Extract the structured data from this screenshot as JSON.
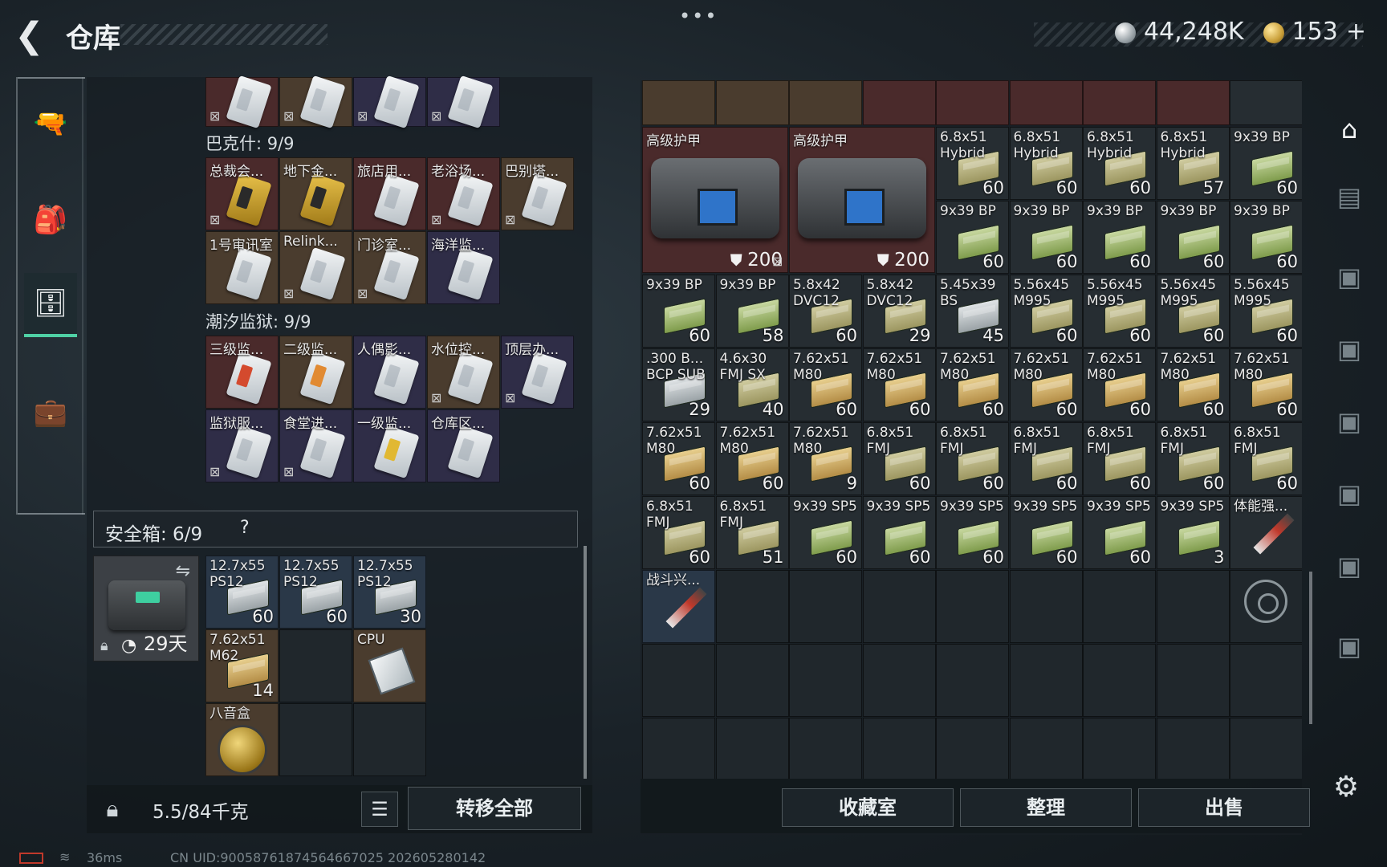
{
  "header": {
    "back_icon": "back-arrow-icon",
    "title": "仓库",
    "more": "•••"
  },
  "currency": {
    "silver_value": "44,248K",
    "gold_value": "153",
    "gold_plus": "+"
  },
  "left_nav": {
    "items": [
      {
        "icon": "gun-icon",
        "glyph": "🔫",
        "active": false
      },
      {
        "icon": "backpack-icon",
        "glyph": "🎒",
        "active": false
      },
      {
        "icon": "container-icon",
        "glyph": "🗄",
        "active": true
      },
      {
        "icon": "briefcase-icon",
        "glyph": "💼",
        "active": false
      }
    ]
  },
  "left_panel": {
    "sections": {
      "bakesh": "巴克什: 9/9",
      "chaoxi": "潮汐监狱: 9/9"
    },
    "top_row": [
      {
        "color": "c-red",
        "flag": "⊠"
      },
      {
        "color": "c-gold",
        "flag": "⊠"
      },
      {
        "color": "c-purple",
        "flag": "⊠"
      },
      {
        "color": "c-purple",
        "flag": "⊠"
      }
    ],
    "bakesh_items": [
      {
        "name": "总裁会...",
        "color": "c-red",
        "card": "k-gold",
        "flag": "⊠"
      },
      {
        "name": "地下金...",
        "color": "c-gold",
        "card": "k-gold",
        "flag": ""
      },
      {
        "name": "旅店用...",
        "color": "c-red",
        "card": "",
        "flag": ""
      },
      {
        "name": "老浴场...",
        "color": "c-red",
        "card": "",
        "flag": "⊠"
      },
      {
        "name": "巴别塔...",
        "color": "c-gold",
        "card": "",
        "flag": "⊠"
      },
      {
        "name": "1号审讯室",
        "color": "c-gold",
        "card": "",
        "flag": ""
      },
      {
        "name": "Relink...",
        "color": "c-gold",
        "card": "",
        "flag": "⊠"
      },
      {
        "name": "门诊室...",
        "color": "c-gold",
        "card": "",
        "flag": "⊠"
      },
      {
        "name": "海洋监...",
        "color": "c-purple",
        "card": "",
        "flag": ""
      }
    ],
    "chaoxi_items": [
      {
        "name": "三级监...",
        "color": "c-red",
        "card": "k-red",
        "flag": ""
      },
      {
        "name": "二级监...",
        "color": "c-gold",
        "card": "k-orange",
        "flag": ""
      },
      {
        "name": "人偶影...",
        "color": "c-purple",
        "card": "",
        "flag": ""
      },
      {
        "name": "水位控...",
        "color": "c-gold",
        "card": "",
        "flag": "⊠"
      },
      {
        "name": "顶层办...",
        "color": "c-purple",
        "card": "",
        "flag": "⊠"
      },
      {
        "name": "监狱服...",
        "color": "c-purple",
        "card": "",
        "flag": "⊠"
      },
      {
        "name": "食堂进...",
        "color": "c-purple",
        "card": "",
        "flag": "⊠"
      },
      {
        "name": "一级监...",
        "color": "c-purple",
        "card": "k-yellow",
        "flag": ""
      },
      {
        "name": "仓库区...",
        "color": "c-purple",
        "card": "",
        "flag": ""
      }
    ],
    "safebox": {
      "label": "安全箱: 6/9",
      "help": "?",
      "swap_icon": "swap-icon",
      "lock_icon": "lock-icon",
      "clock_icon": "clock-icon",
      "days": "29天",
      "items": [
        {
          "name": "12.7x55 PS12",
          "count": "60",
          "color": "c-blue",
          "type": "ammo",
          "ammo": "grey"
        },
        {
          "name": "12.7x55 PS12",
          "count": "60",
          "color": "c-blue",
          "type": "ammo",
          "ammo": "grey"
        },
        {
          "name": "12.7x55 PS12",
          "count": "30",
          "color": "c-blue",
          "type": "ammo",
          "ammo": "grey"
        },
        {
          "name": "7.62x51 M62",
          "count": "14",
          "color": "c-gold",
          "type": "ammo",
          "ammo": "tan"
        },
        {
          "name": "",
          "count": "",
          "color": "c-empty",
          "type": "empty"
        },
        {
          "name": "CPU",
          "count": "",
          "color": "c-gold",
          "type": "cpu"
        },
        {
          "name": "八音盒",
          "count": "",
          "color": "c-gold",
          "type": "coin"
        },
        {
          "name": "",
          "count": "",
          "color": "c-empty",
          "type": "empty"
        },
        {
          "name": "",
          "count": "",
          "color": "c-empty",
          "type": "empty"
        }
      ]
    },
    "bottom": {
      "lock_icon": "lock-icon",
      "weight": "5.5/84千克",
      "list_icon": "list-icon",
      "transfer_label": "转移全部"
    }
  },
  "right_panel": {
    "armor": [
      {
        "name": "高级护甲",
        "durability": "200",
        "shield_icon": "shield-icon",
        "flag": ""
      },
      {
        "name": "高级护甲",
        "durability": "200",
        "shield_icon": "shield-icon",
        "flag": "⊠"
      }
    ],
    "rows": [
      [
        {
          "name": "6.8x51 Hybrid",
          "count": "60",
          "color": "c-dark",
          "ammo": "olive"
        },
        {
          "name": "6.8x51 Hybrid",
          "count": "60",
          "color": "c-dark",
          "ammo": "olive"
        },
        {
          "name": "6.8x51 Hybrid",
          "count": "60",
          "color": "c-dark",
          "ammo": "olive"
        },
        {
          "name": "6.8x51 Hybrid",
          "count": "57",
          "color": "c-dark",
          "ammo": "olive"
        },
        {
          "name": "9x39 BP",
          "count": "60",
          "color": "c-dark",
          "ammo": "green"
        }
      ],
      [
        {
          "name": "9x39 BP",
          "count": "60",
          "color": "c-dark",
          "ammo": "green"
        },
        {
          "name": "9x39 BP",
          "count": "60",
          "color": "c-dark",
          "ammo": "green"
        },
        {
          "name": "9x39 BP",
          "count": "60",
          "color": "c-dark",
          "ammo": "green"
        },
        {
          "name": "9x39 BP",
          "count": "60",
          "color": "c-dark",
          "ammo": "green"
        },
        {
          "name": "9x39 BP",
          "count": "60",
          "color": "c-dark",
          "ammo": "green"
        }
      ],
      [
        {
          "name": "9x39 BP",
          "count": "60",
          "color": "c-dark",
          "ammo": "green"
        },
        {
          "name": "9x39 BP",
          "count": "58",
          "color": "c-dark",
          "ammo": "green"
        },
        {
          "name": "5.8x42 DVC12",
          "count": "60",
          "color": "c-dark",
          "ammo": "olive"
        },
        {
          "name": "5.8x42 DVC12",
          "count": "29",
          "color": "c-dark",
          "ammo": "olive"
        },
        {
          "name": "5.45x39 BS",
          "count": "45",
          "color": "c-dark",
          "ammo": "grey"
        },
        {
          "name": "5.56x45 M995",
          "count": "60",
          "color": "c-dark",
          "ammo": "olive"
        },
        {
          "name": "5.56x45 M995",
          "count": "60",
          "color": "c-dark",
          "ammo": "olive"
        },
        {
          "name": "5.56x45 M995",
          "count": "60",
          "color": "c-dark",
          "ammo": "olive"
        },
        {
          "name": "5.56x45 M995",
          "count": "60",
          "color": "c-dark",
          "ammo": "olive"
        }
      ],
      [
        {
          "name": ".300 B... BCP SUB",
          "count": "29",
          "color": "c-dark",
          "ammo": "grey"
        },
        {
          "name": "4.6x30 FMJ SX",
          "count": "40",
          "color": "c-dark",
          "ammo": "olive"
        },
        {
          "name": "7.62x51 M80",
          "count": "60",
          "color": "c-dark",
          "ammo": "tan"
        },
        {
          "name": "7.62x51 M80",
          "count": "60",
          "color": "c-dark",
          "ammo": "tan"
        },
        {
          "name": "7.62x51 M80",
          "count": "60",
          "color": "c-dark",
          "ammo": "tan"
        },
        {
          "name": "7.62x51 M80",
          "count": "60",
          "color": "c-dark",
          "ammo": "tan"
        },
        {
          "name": "7.62x51 M80",
          "count": "60",
          "color": "c-dark",
          "ammo": "tan"
        },
        {
          "name": "7.62x51 M80",
          "count": "60",
          "color": "c-dark",
          "ammo": "tan"
        },
        {
          "name": "7.62x51 M80",
          "count": "60",
          "color": "c-dark",
          "ammo": "tan"
        }
      ],
      [
        {
          "name": "7.62x51 M80",
          "count": "60",
          "color": "c-dark",
          "ammo": "tan"
        },
        {
          "name": "7.62x51 M80",
          "count": "60",
          "color": "c-dark",
          "ammo": "tan"
        },
        {
          "name": "7.62x51 M80",
          "count": "9",
          "color": "c-dark",
          "ammo": "tan"
        },
        {
          "name": "6.8x51 FMJ",
          "count": "60",
          "color": "c-dark",
          "ammo": "olive"
        },
        {
          "name": "6.8x51 FMJ",
          "count": "60",
          "color": "c-dark",
          "ammo": "olive"
        },
        {
          "name": "6.8x51 FMJ",
          "count": "60",
          "color": "c-dark",
          "ammo": "olive"
        },
        {
          "name": "6.8x51 FMJ",
          "count": "60",
          "color": "c-dark",
          "ammo": "olive"
        },
        {
          "name": "6.8x51 FMJ",
          "count": "60",
          "color": "c-dark",
          "ammo": "olive"
        },
        {
          "name": "6.8x51 FMJ",
          "count": "60",
          "color": "c-dark",
          "ammo": "olive"
        }
      ],
      [
        {
          "name": "6.8x51 FMJ",
          "count": "60",
          "color": "c-dark",
          "ammo": "olive"
        },
        {
          "name": "6.8x51 FMJ",
          "count": "51",
          "color": "c-dark",
          "ammo": "olive"
        },
        {
          "name": "9x39 SP5",
          "count": "60",
          "color": "c-dark",
          "ammo": "green"
        },
        {
          "name": "9x39 SP5",
          "count": "60",
          "color": "c-dark",
          "ammo": "green"
        },
        {
          "name": "9x39 SP5",
          "count": "60",
          "color": "c-dark",
          "ammo": "green"
        },
        {
          "name": "9x39 SP5",
          "count": "60",
          "color": "c-dark",
          "ammo": "green"
        },
        {
          "name": "9x39 SP5",
          "count": "60",
          "color": "c-dark",
          "ammo": "green"
        },
        {
          "name": "9x39 SP5",
          "count": "3",
          "color": "c-dark",
          "ammo": "green"
        },
        {
          "name": "体能强...",
          "count": "",
          "color": "c-dark",
          "ammo": "syringe"
        }
      ],
      [
        {
          "name": "战斗兴...",
          "count": "",
          "color": "c-blue",
          "ammo": "syringe"
        }
      ]
    ],
    "target_icon": "target-icon",
    "buttons": {
      "collection": "收藏室",
      "sort": "整理",
      "sell": "出售"
    }
  },
  "right_tabs": [
    {
      "icon": "warehouse-icon",
      "glyph": "⌂",
      "active": true
    },
    {
      "icon": "tab-iv-icon",
      "glyph": "▤",
      "active": false
    },
    {
      "icon": "tab-v-icon",
      "glyph": "▣",
      "active": false
    },
    {
      "icon": "tab-v-icon",
      "glyph": "▣",
      "active": false
    },
    {
      "icon": "tab-v-icon",
      "glyph": "▣",
      "active": false
    },
    {
      "icon": "tab-v-icon",
      "glyph": "▣",
      "active": false
    },
    {
      "icon": "tab-v-icon",
      "glyph": "▣",
      "active": false
    },
    {
      "icon": "tab-v-icon",
      "glyph": "▣",
      "active": false
    }
  ],
  "settings": {
    "icon": "gear-icon",
    "glyph": "⚙"
  },
  "status": {
    "ping": "36ms",
    "uid": "CN UID:900587618745646670​25 202605280142"
  }
}
